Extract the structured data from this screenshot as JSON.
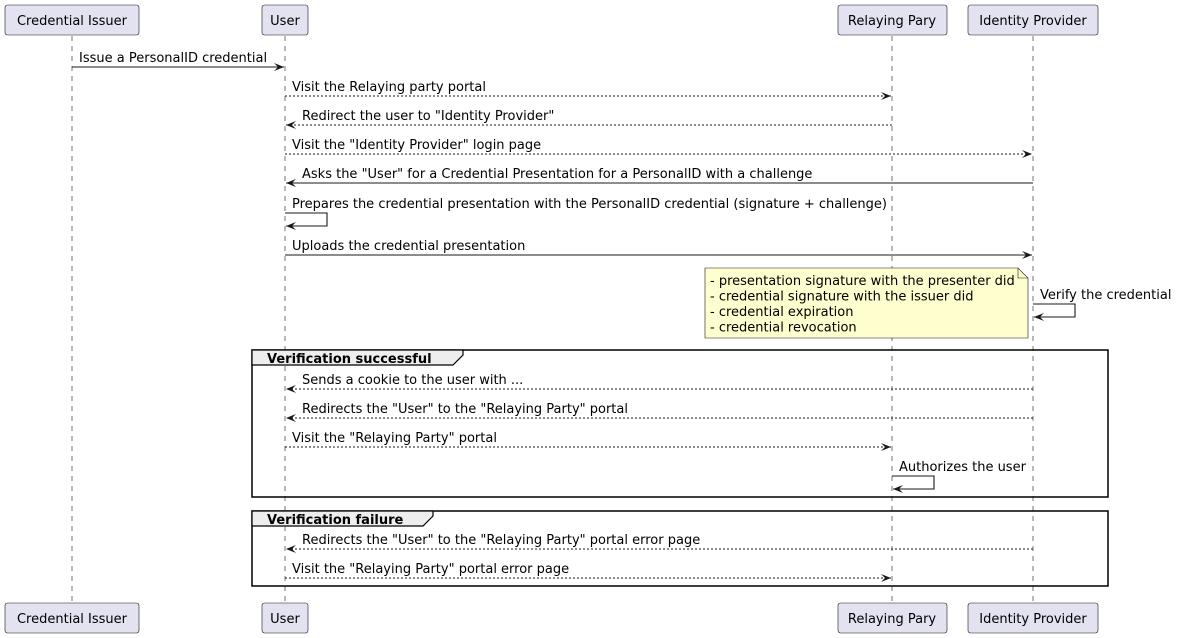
{
  "participants": [
    {
      "id": "ci",
      "label": "Credential Issuer"
    },
    {
      "id": "user",
      "label": "User"
    },
    {
      "id": "rp",
      "label": "Relaying Pary"
    },
    {
      "id": "idp",
      "label": "Identity Provider"
    }
  ],
  "messages": [
    {
      "from": "ci",
      "to": "user",
      "style": "solid",
      "label": "Issue a PersonalID credential"
    },
    {
      "from": "user",
      "to": "rp",
      "style": "dashed",
      "label": "Visit the Relaying party portal"
    },
    {
      "from": "rp",
      "to": "user",
      "style": "dashed",
      "label": "Redirect the user to \"Identity Provider\""
    },
    {
      "from": "user",
      "to": "idp",
      "style": "dashed",
      "label": "Visit the \"Identity Provider\" login page"
    },
    {
      "from": "idp",
      "to": "user",
      "style": "solid",
      "label": "Asks the \"User\" for a Credential Presentation for a PersonalID with a challenge"
    },
    {
      "from": "user",
      "to": "user",
      "style": "solid",
      "label": "Prepares the credential presentation with the PersonalID credential (signature + challenge)"
    },
    {
      "from": "user",
      "to": "idp",
      "style": "solid",
      "label": "Uploads the credential presentation"
    },
    {
      "from": "idp",
      "to": "idp",
      "style": "solid",
      "label": "Verify the credential"
    },
    {
      "from": "idp",
      "to": "user",
      "style": "dashed",
      "label": "Sends a cookie to the user with ..."
    },
    {
      "from": "idp",
      "to": "user",
      "style": "dashed",
      "label": "Redirects the \"User\" to the \"Relaying Party\" portal"
    },
    {
      "from": "user",
      "to": "rp",
      "style": "dashed",
      "label": "Visit the \"Relaying Party\" portal"
    },
    {
      "from": "rp",
      "to": "rp",
      "style": "solid",
      "label": "Authorizes the user"
    },
    {
      "from": "idp",
      "to": "user",
      "style": "dashed",
      "label": "Redirects the \"User\" to the \"Relaying Party\" portal error page"
    },
    {
      "from": "user",
      "to": "rp",
      "style": "dashed",
      "label": "Visit the \"Relaying Party\" portal error page"
    }
  ],
  "note": {
    "lines": [
      "- presentation signature with the presenter did",
      "- credential signature with the issuer did",
      "- credential expiration",
      "- credential revocation"
    ]
  },
  "groups": [
    {
      "label": "Verification successful"
    },
    {
      "label": "Verification failure"
    }
  ],
  "colors": {
    "participant": "#e2e2f0",
    "note": "#fefece",
    "group_header": "#eeeeee"
  }
}
